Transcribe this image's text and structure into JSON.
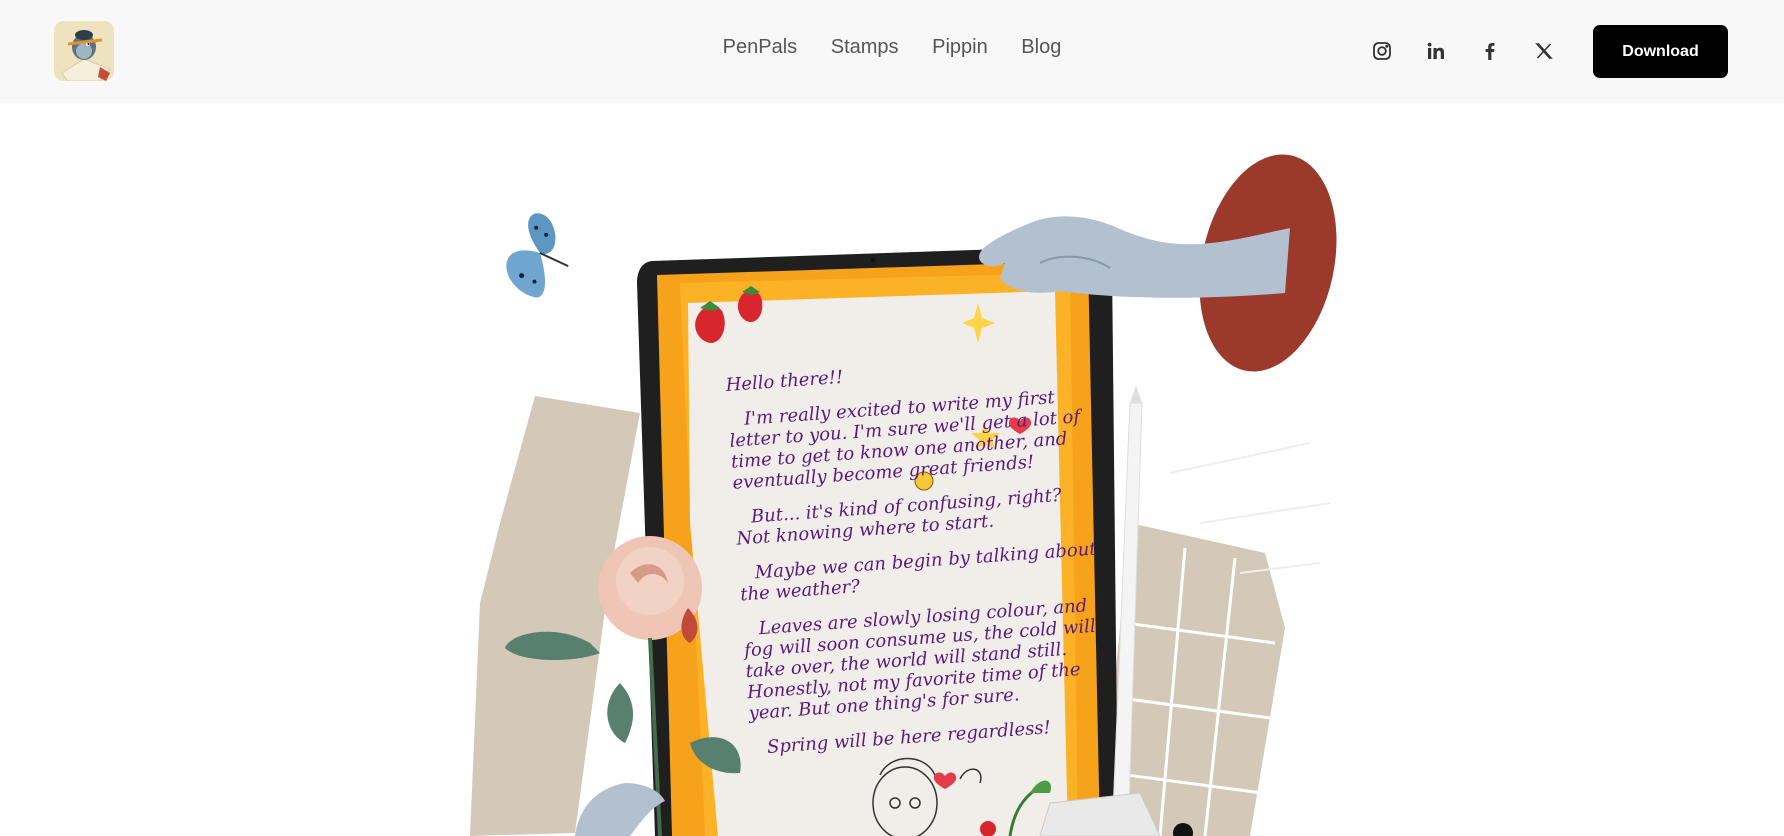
{
  "nav": {
    "links": [
      {
        "label": "PenPals"
      },
      {
        "label": "Stamps"
      },
      {
        "label": "Pippin"
      },
      {
        "label": "Blog"
      }
    ]
  },
  "socials": [
    {
      "icon": "instagram-icon"
    },
    {
      "icon": "linkedin-icon"
    },
    {
      "icon": "facebook-icon"
    },
    {
      "icon": "x-icon"
    }
  ],
  "download_label": "Download",
  "letter": {
    "greeting": "Hello there!!",
    "p1": "I'm really excited to write my first letter to you. I'm sure we'll get a lot of time to get to know one another, and eventually become great friends!",
    "p2": "But... it's kind of confusing, right? Not knowing where to start.",
    "p3": "Maybe we can begin by talking about the weather?",
    "p4": "Leaves are slowly losing colour, and fog will soon consume us, the cold will take over, the world will stand still. Honestly, not my favorite time of the year. But one thing's for sure.",
    "p5": "Spring will be here regardless!"
  },
  "colors": {
    "header_bg": "#f8f8f8",
    "button_bg": "#000000",
    "letter_ink": "#5a1a7a",
    "tablet_frame": "#f7a21b",
    "paper": "#f1eee9",
    "red_oval": "#9b3a2a"
  }
}
